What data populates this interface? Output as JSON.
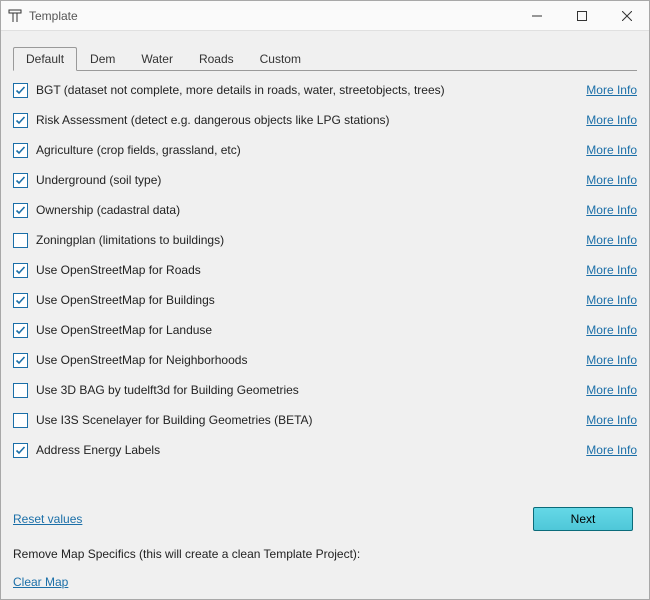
{
  "window": {
    "title": "Template"
  },
  "tabs": [
    {
      "label": "Default",
      "active": true
    },
    {
      "label": "Dem",
      "active": false
    },
    {
      "label": "Water",
      "active": false
    },
    {
      "label": "Roads",
      "active": false
    },
    {
      "label": "Custom",
      "active": false
    }
  ],
  "options": [
    {
      "name": "bgt",
      "checked": true,
      "label": "BGT (dataset not complete, more details in roads, water, streetobjects, trees)",
      "more": "More Info"
    },
    {
      "name": "risk-assessment",
      "checked": true,
      "label": "Risk Assessment (detect e.g. dangerous objects like LPG stations)",
      "more": "More Info"
    },
    {
      "name": "agriculture",
      "checked": true,
      "label": "Agriculture (crop fields, grassland, etc)",
      "more": "More Info"
    },
    {
      "name": "underground",
      "checked": true,
      "label": "Underground (soil type)",
      "more": "More Info"
    },
    {
      "name": "ownership",
      "checked": true,
      "label": "Ownership (cadastral data)",
      "more": "More Info"
    },
    {
      "name": "zoningplan",
      "checked": false,
      "label": "Zoningplan (limitations to buildings)",
      "more": "More Info"
    },
    {
      "name": "osm-roads",
      "checked": true,
      "label": "Use OpenStreetMap for Roads",
      "more": "More Info"
    },
    {
      "name": "osm-buildings",
      "checked": true,
      "label": "Use OpenStreetMap for Buildings",
      "more": "More Info"
    },
    {
      "name": "osm-landuse",
      "checked": true,
      "label": "Use OpenStreetMap for Landuse",
      "more": "More Info"
    },
    {
      "name": "osm-neighborhoods",
      "checked": true,
      "label": "Use OpenStreetMap for Neighborhoods",
      "more": "More Info"
    },
    {
      "name": "3d-bag",
      "checked": false,
      "label": "Use 3D BAG by tudelft3d for Building Geometries",
      "more": "More Info"
    },
    {
      "name": "i3s-scenelayer",
      "checked": false,
      "label": "Use I3S Scenelayer for Building Geometries (BETA)",
      "more": "More Info"
    },
    {
      "name": "address-energy-labels",
      "checked": true,
      "label": "Address Energy Labels",
      "more": "More Info"
    }
  ],
  "footer": {
    "reset_label": "Reset values",
    "next_label": "Next",
    "remove_text": "Remove Map Specifics (this will  create a clean Template Project):",
    "clear_label": "Clear Map"
  }
}
